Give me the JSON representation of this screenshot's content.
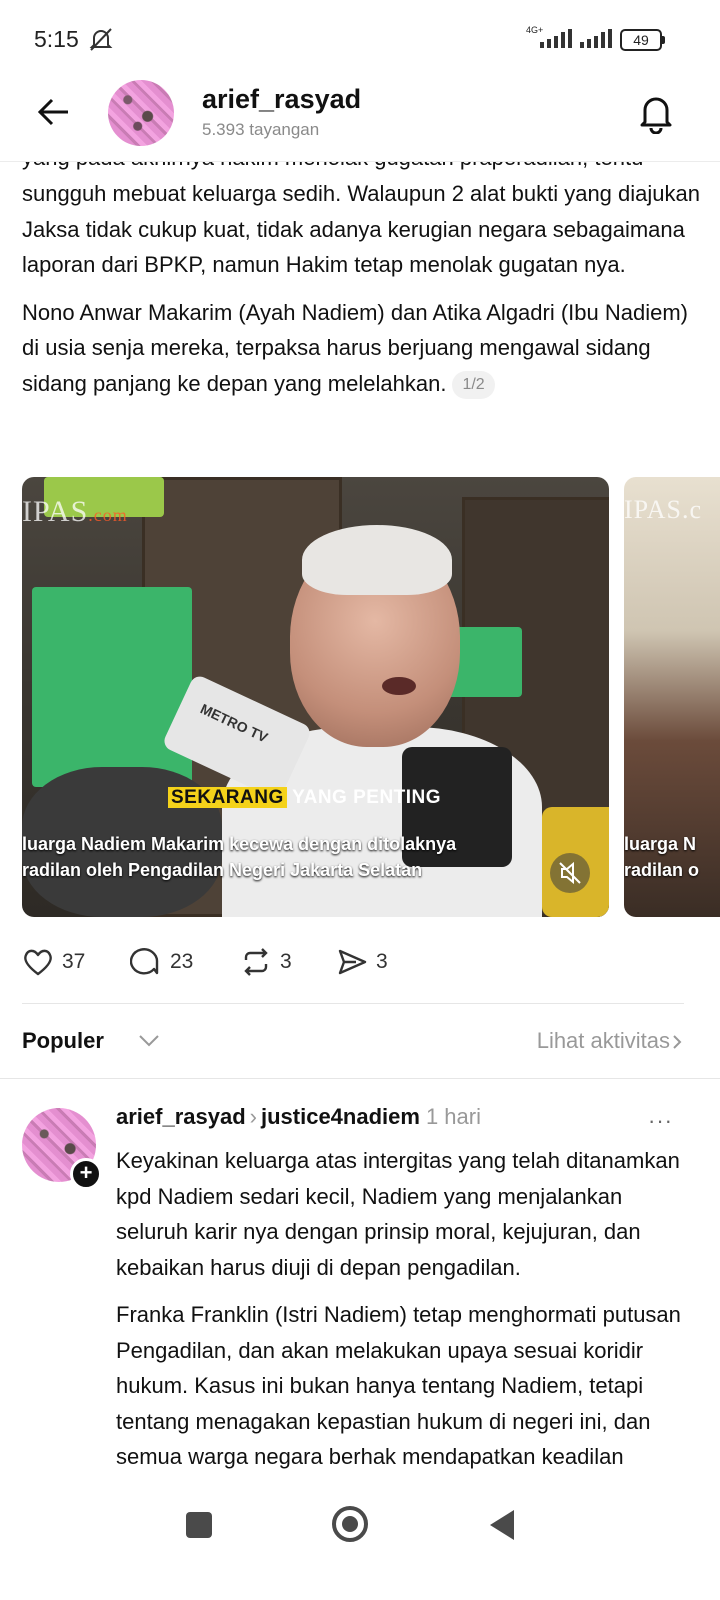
{
  "status_bar": {
    "time": "5:15",
    "network": "4G+",
    "battery": "49"
  },
  "header": {
    "username": "arief_rasyad",
    "views": "5.393 tayangan"
  },
  "post": {
    "clipped_line": "yang pada akhirnya hakim menolak gugatan praperadilan, tentu",
    "paragraph1": "sungguh mebuat keluarga sedih.  Walaupun 2 alat bukti yang diajukan Jaksa tidak cukup kuat, tidak adanya kerugian negara sebagaimana laporan dari BPKP, namun Hakim tetap menolak gugatan nya.",
    "paragraph2": "Nono Anwar Makarim (Ayah Nadiem) dan  Atika Algadri (Ibu Nadiem) di usia senja mereka, terpaksa harus berjuang mengawal sidang sidang panjang ke depan yang melelahkan.",
    "page_indicator": "1/2"
  },
  "media": {
    "watermark": "IPAS",
    "watermark_suffix": ".com",
    "mic_label": "METRO TV",
    "caption_highlight": "SEKARANG",
    "caption_rest": "YANG PENTING",
    "subtitle_line1": "luarga Nadiem Makarim kecewa dengan ditolaknya",
    "subtitle_line2": "radilan oleh Pengadilan Negeri Jakarta Selatan",
    "side_subtitle_line1": "luarga N",
    "side_subtitle_line2": "radilan o",
    "side_watermark": "IPAS.c"
  },
  "actions": {
    "likes": "37",
    "comments": "23",
    "reposts": "3",
    "shares": "3"
  },
  "sort": {
    "label": "Populer",
    "activity_link": "Lihat aktivitas"
  },
  "reply": {
    "username": "arief_rasyad",
    "reply_to": "justice4nadiem",
    "time": "1 hari",
    "more": "···",
    "paragraph1": "Keyakinan keluarga atas intergitas yang telah ditanamkan kpd Nadiem sedari kecil, Nadiem yang menjalankan seluruh karir nya dengan prinsip moral, kejujuran, dan kebaikan harus diuji di depan pengadilan.",
    "paragraph2": "Franka Franklin (Istri Nadiem) tetap menghormati putusan Pengadilan, dan akan melakukan upaya sesuai koridir hukum. Kasus ini bukan hanya tentang Nadiem, tetapi tentang menagakan kepastian hukum di negeri ini, dan semua warga negara berhak mendapatkan keadilan"
  },
  "icons": {
    "back": "arrow-left-icon",
    "notification": "bell-icon",
    "like": "heart-icon",
    "comment": "comment-bubble-icon",
    "repost": "repost-icon",
    "share": "send-icon",
    "mute": "volume-muted-icon"
  },
  "colors": {
    "text": "#111111",
    "muted": "#8a8a8a",
    "divider": "#e6e6e6",
    "caption_highlight": "#f4d21a"
  }
}
